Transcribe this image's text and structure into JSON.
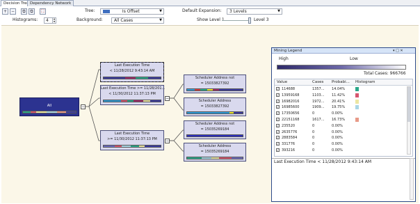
{
  "tabs": [
    {
      "label": "Decision Tree",
      "active": true
    },
    {
      "label": "Dependency Network",
      "active": false
    }
  ],
  "toolbar": {
    "tree_label": "Tree:",
    "tree_value": "Is Offset",
    "tree_color": "#3f6fbf",
    "background_label": "Background:",
    "background_value": "All Cases",
    "histograms_label": "Histograms:",
    "histograms_value": "4",
    "default_expansion_label": "Default Expansion:",
    "default_expansion_value": "3 Levels",
    "show_level_label": "Show Level 1",
    "show_level_end": "Level 3",
    "show_level_fraction": 1.0
  },
  "tree": {
    "root": {
      "label": "All"
    },
    "nodes": [
      {
        "line1": "Last Execution Time",
        "line2": "< 11/28/2012 9:43:14 AM",
        "selected": true
      },
      {
        "line1": "Last Execution Time >= 11/28/201...",
        "line2": "< 11/30/2012 11:37:13 PM",
        "selected": false
      },
      {
        "line1": "Last Execution Time",
        "line2": ">= 11/30/2012 11:37:13 PM",
        "selected": false
      },
      {
        "line1": "Scheduler Address not",
        "line2": "= 15033827392",
        "selected": false
      },
      {
        "line1": "Scheduler Address",
        "line2": "= 15033827392",
        "selected": false
      },
      {
        "line1": "Scheduler Address not",
        "line2": "= 15035269184",
        "selected": false
      },
      {
        "line1": "Scheduler Address",
        "line2": "= 15035269184",
        "selected": false
      }
    ],
    "expander_minus": "−",
    "expander_plus": "+"
  },
  "legend": {
    "title": "Mining Legend",
    "controls": "▾ □ ✕",
    "high": "High",
    "low": "Low",
    "total_cases": "Total Cases: 966766",
    "columns": [
      "Value",
      "Cases",
      "Probabi...",
      "Histogram"
    ],
    "rows": [
      {
        "value": "114688",
        "cases": "1357...",
        "prob": "14.04%",
        "color": "#2aa88a"
      },
      {
        "value": "13959168",
        "cases": "1103...",
        "prob": "11.42%",
        "color": "#d6576f"
      },
      {
        "value": "16982016",
        "cases": "1972...",
        "prob": "20.41%",
        "color": "#ece6a3"
      },
      {
        "value": "16985600",
        "cases": "1909...",
        "prob": "19.75%",
        "color": "#a9d6e6"
      },
      {
        "value": "17350656",
        "cases": "0",
        "prob": "0.00%",
        "color": ""
      },
      {
        "value": "22151168",
        "cases": "1617...",
        "prob": "16.73%",
        "color": "#e89a88"
      },
      {
        "value": "235520",
        "cases": "0",
        "prob": "0.00%",
        "color": ""
      },
      {
        "value": "2635776",
        "cases": "0",
        "prob": "0.00%",
        "color": ""
      },
      {
        "value": "2883584",
        "cases": "0",
        "prob": "0.00%",
        "color": ""
      },
      {
        "value": "331776",
        "cases": "0",
        "prob": "0.00%",
        "color": ""
      },
      {
        "value": "393216",
        "cases": "0",
        "prob": "0.00%",
        "color": ""
      }
    ],
    "status": "Last Execution Time < 11/28/2012 9:43:14 AM"
  }
}
